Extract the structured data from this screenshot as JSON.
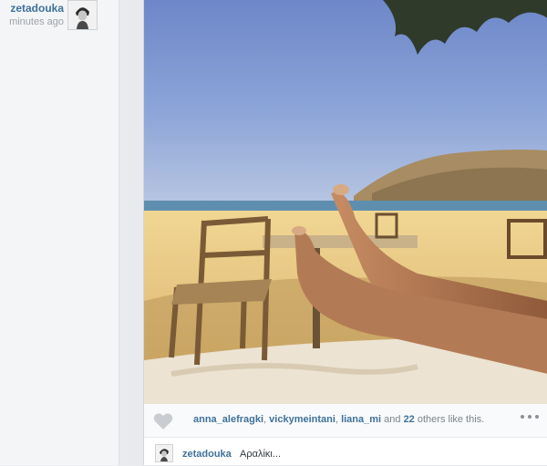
{
  "post": {
    "author": "zetadouka",
    "time_ago": "minutes ago"
  },
  "likes": {
    "users": [
      "anna_alefragki",
      "vickymeintani",
      "liana_mi"
    ],
    "sep_comma": ", ",
    "and_text": " and ",
    "others_count": "22",
    "others_suffix": " others like this."
  },
  "comment": {
    "user": "zetadouka",
    "text": "Αραλίκι..."
  },
  "icons": {
    "like": "heart-icon",
    "more": "more-options-icon"
  },
  "colors": {
    "username_link": "#3f729b",
    "meta_text": "#9ea3a8"
  }
}
